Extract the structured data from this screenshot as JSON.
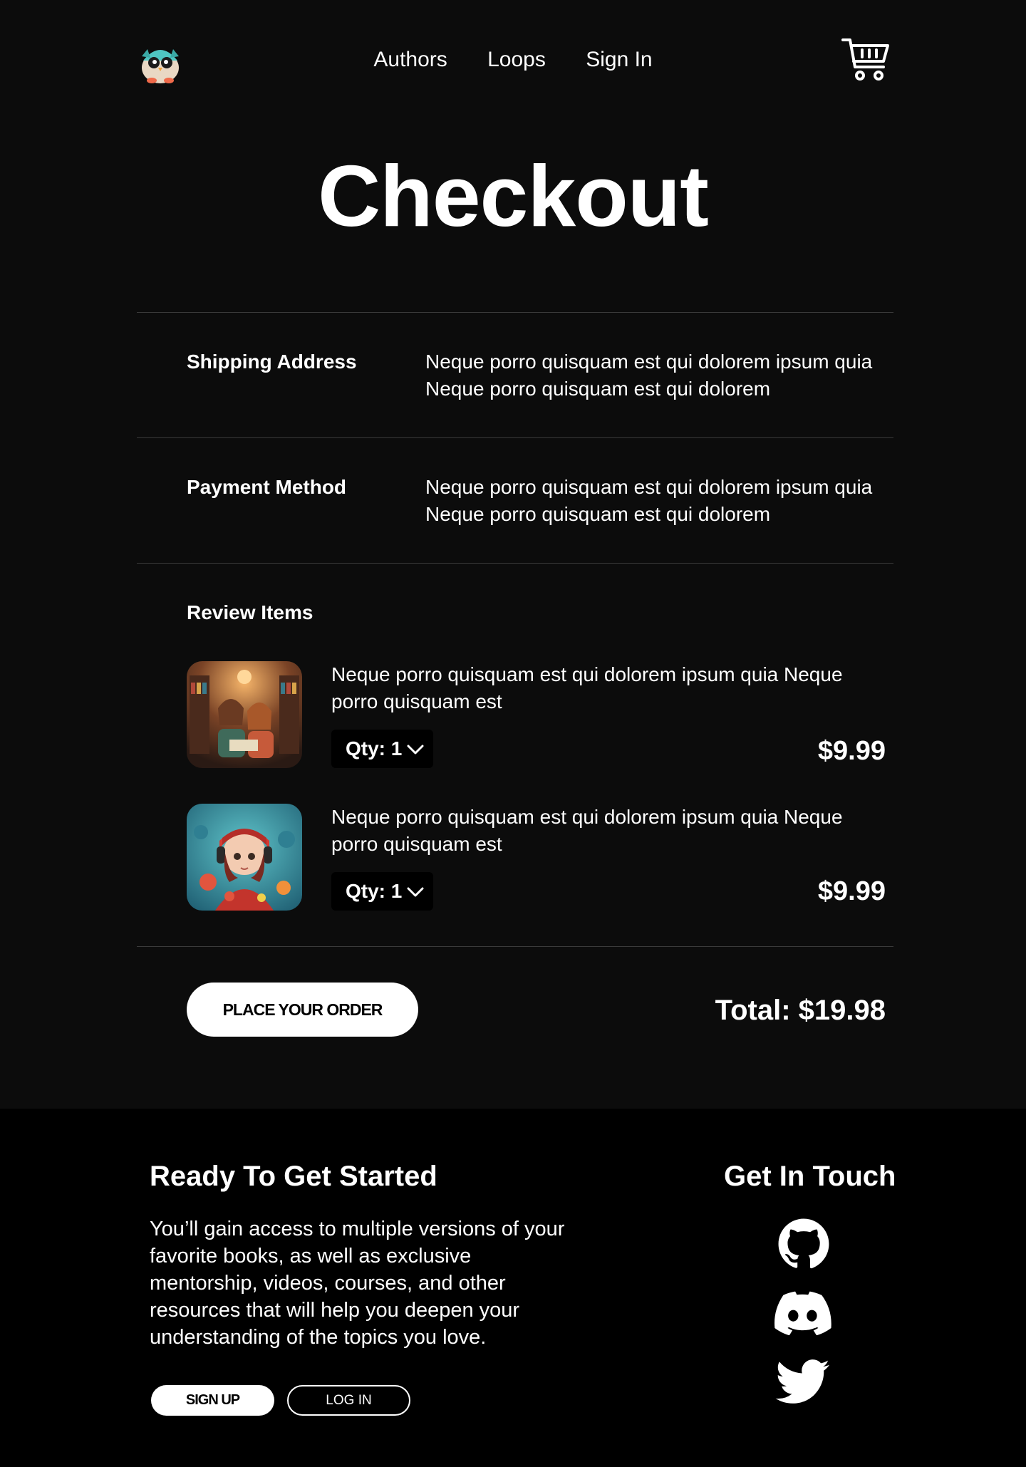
{
  "nav": {
    "links": [
      "Authors",
      "Loops",
      "Sign In"
    ]
  },
  "page": {
    "title": "Checkout"
  },
  "shipping": {
    "label": "Shipping Address",
    "value": "Neque porro quisquam est qui dolorem ipsum quia Neque porro quisquam est qui dolorem"
  },
  "payment": {
    "label": "Payment Method",
    "value": "Neque porro quisquam est qui dolorem ipsum quia Neque porro quisquam est qui dolorem"
  },
  "review": {
    "label": "Review Items",
    "items": [
      {
        "description": "Neque porro quisquam est qui dolorem ipsum quia Neque porro quisquam est",
        "qty": "Qty: 1",
        "price": "$9.99",
        "thumb": "cozy-library-children-illustration"
      },
      {
        "description": "Neque porro quisquam est qui dolorem ipsum quia Neque porro quisquam est",
        "qty": "Qty: 1",
        "price": "$9.99",
        "thumb": "girl-with-headphones-illustration"
      }
    ]
  },
  "order": {
    "button_label": "PLACE YOUR ORDER",
    "total": "Total: $19.98"
  },
  "footer": {
    "title": "Ready To Get Started",
    "text": "You’ll gain access to multiple versions of your favorite books, as well as exclusive mentorship, videos, courses, and other resources that will help you deepen your understanding of the topics you love.",
    "signup_label": "SIGN UP",
    "login_label": "LOG IN",
    "touch_title": "Get In Touch",
    "socials": [
      "github-icon",
      "discord-icon",
      "twitter-icon"
    ]
  },
  "colors": {
    "background": "#0c0c0c",
    "footer_background": "#000000",
    "text": "#ffffff",
    "divider": "#3a3a3a"
  }
}
